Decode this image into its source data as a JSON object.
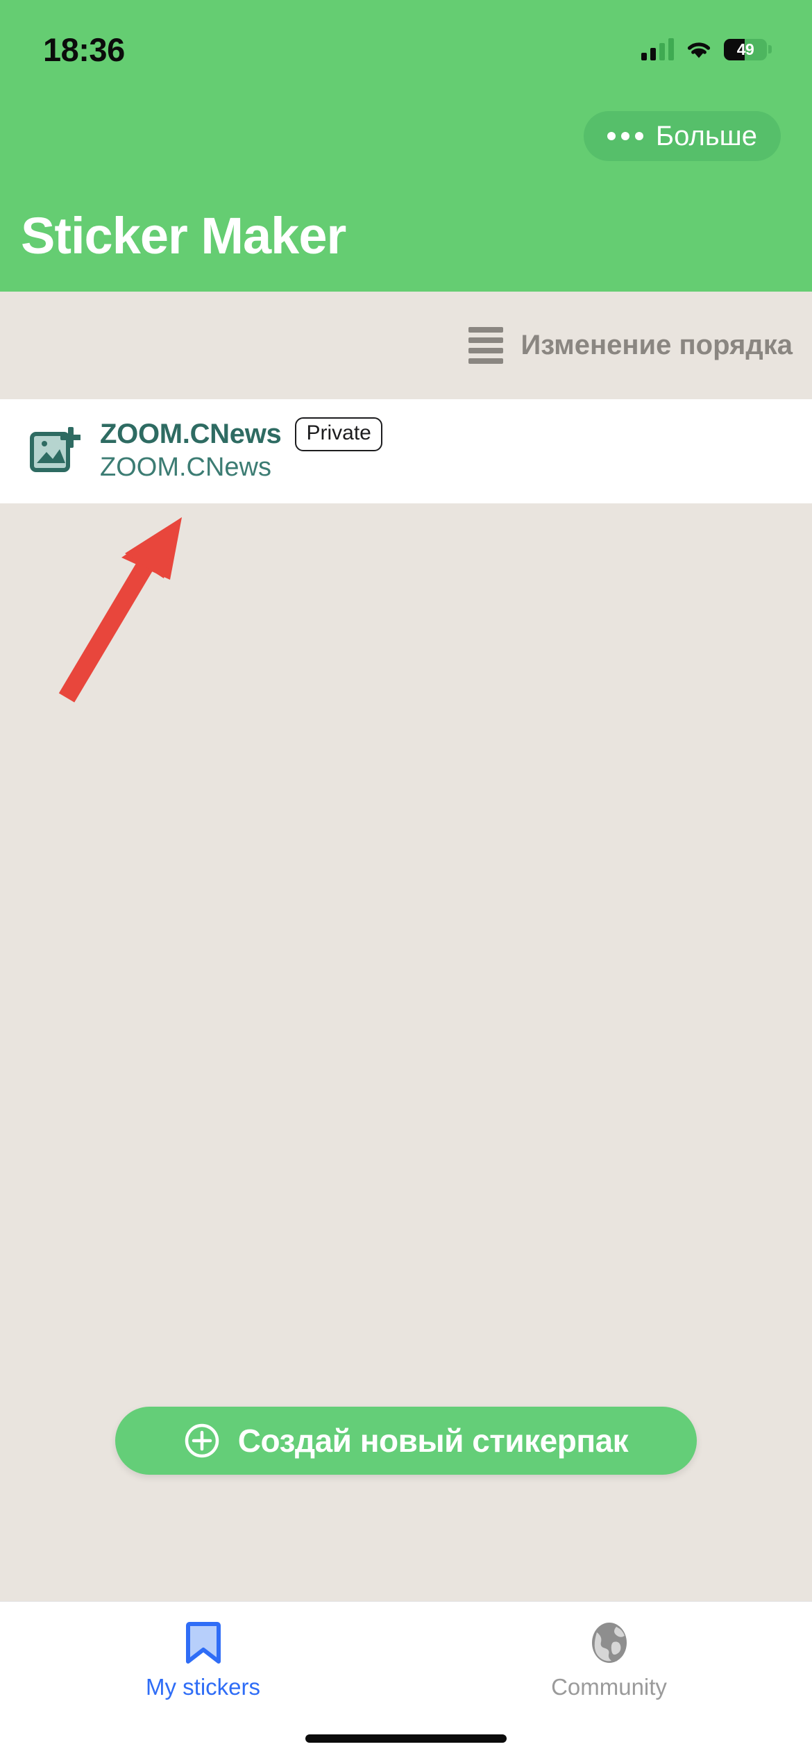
{
  "status_bar": {
    "time": "18:36",
    "battery_level": "49",
    "icons": [
      "cellular-signal-icon",
      "wifi-icon",
      "battery-icon"
    ]
  },
  "header": {
    "title": "Sticker Maker",
    "more_button_label": "Больше",
    "more_button_icon": "ellipsis-icon",
    "background_color": "#65CD72",
    "more_button_color": "#56BF6A"
  },
  "reorder_bar": {
    "label": "Изменение порядка",
    "icon": "hamburger-reorder-icon",
    "background_color": "#E9E4DE",
    "text_color": "#8A8681"
  },
  "packs": [
    {
      "title": "ZOOM.CNews",
      "subtitle": "ZOOM.CNews",
      "badge": "Private",
      "icon": "add-photo-icon",
      "title_color": "#2E6B62"
    }
  ],
  "annotation": {
    "type": "arrow",
    "color": "#E8463C"
  },
  "create_button": {
    "label": "Создай новый стикерпак",
    "icon": "plus-circle-icon",
    "color": "#64CE78"
  },
  "tab_bar": {
    "tabs": [
      {
        "label": "My stickers",
        "icon": "bookmark-icon",
        "active": true,
        "color": "#2F6DF6"
      },
      {
        "label": "Community",
        "icon": "globe-icon",
        "active": false,
        "color": "#9A9A9A"
      }
    ]
  }
}
